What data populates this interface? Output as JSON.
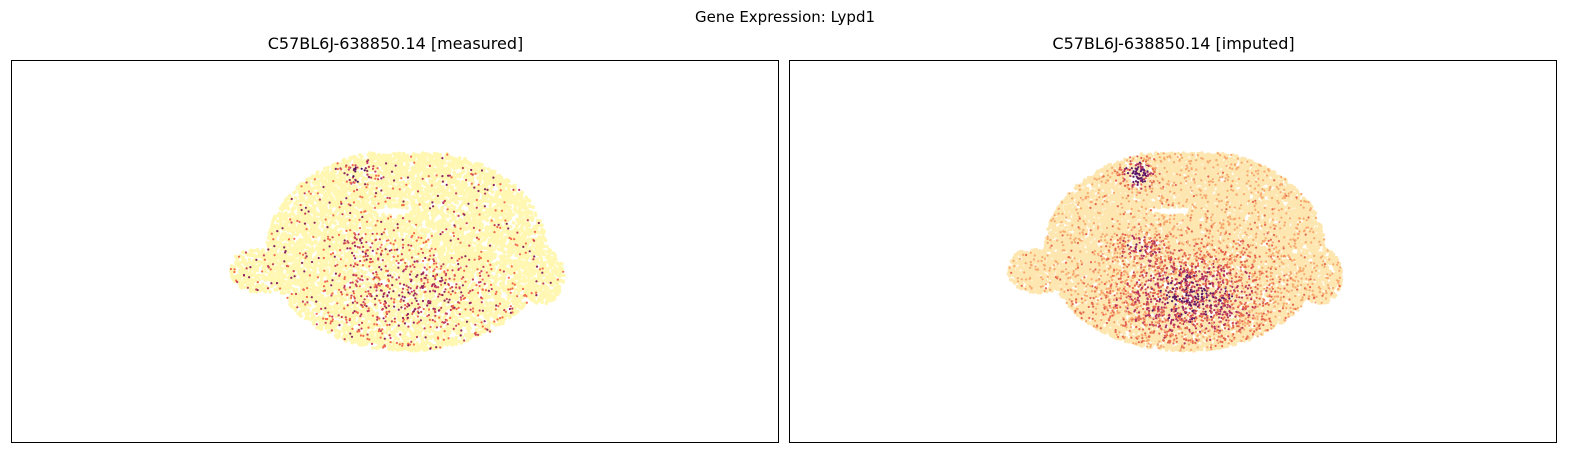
{
  "figure": {
    "suptitle": "Gene Expression: Lypd1"
  },
  "chart_data": [
    {
      "type": "scatter",
      "title": "C57BL6J-638850.14 [measured]",
      "xlabel": "",
      "ylabel": "",
      "ticks_visible": false,
      "grid": false,
      "colormap": "magma_r",
      "point_count_approx": 9000,
      "background_color": "#fff7b2",
      "hotspot_colors": [
        "#f26b4d",
        "#c63f5e",
        "#8a2361",
        "#4a125e"
      ],
      "high_expression_regions": [
        "upper nucleus",
        "lower central body"
      ]
    },
    {
      "type": "scatter",
      "title": "C57BL6J-638850.14 [imputed]",
      "xlabel": "",
      "ylabel": "",
      "ticks_visible": false,
      "grid": false,
      "colormap": "magma_r",
      "point_count_approx": 14000,
      "background_color": "#fde6b0",
      "hotspot_colors": [
        "#f7a86e",
        "#e5664f",
        "#b23262",
        "#5e1766"
      ],
      "high_expression_regions": [
        "upper nucleus",
        "lower central body"
      ]
    }
  ]
}
